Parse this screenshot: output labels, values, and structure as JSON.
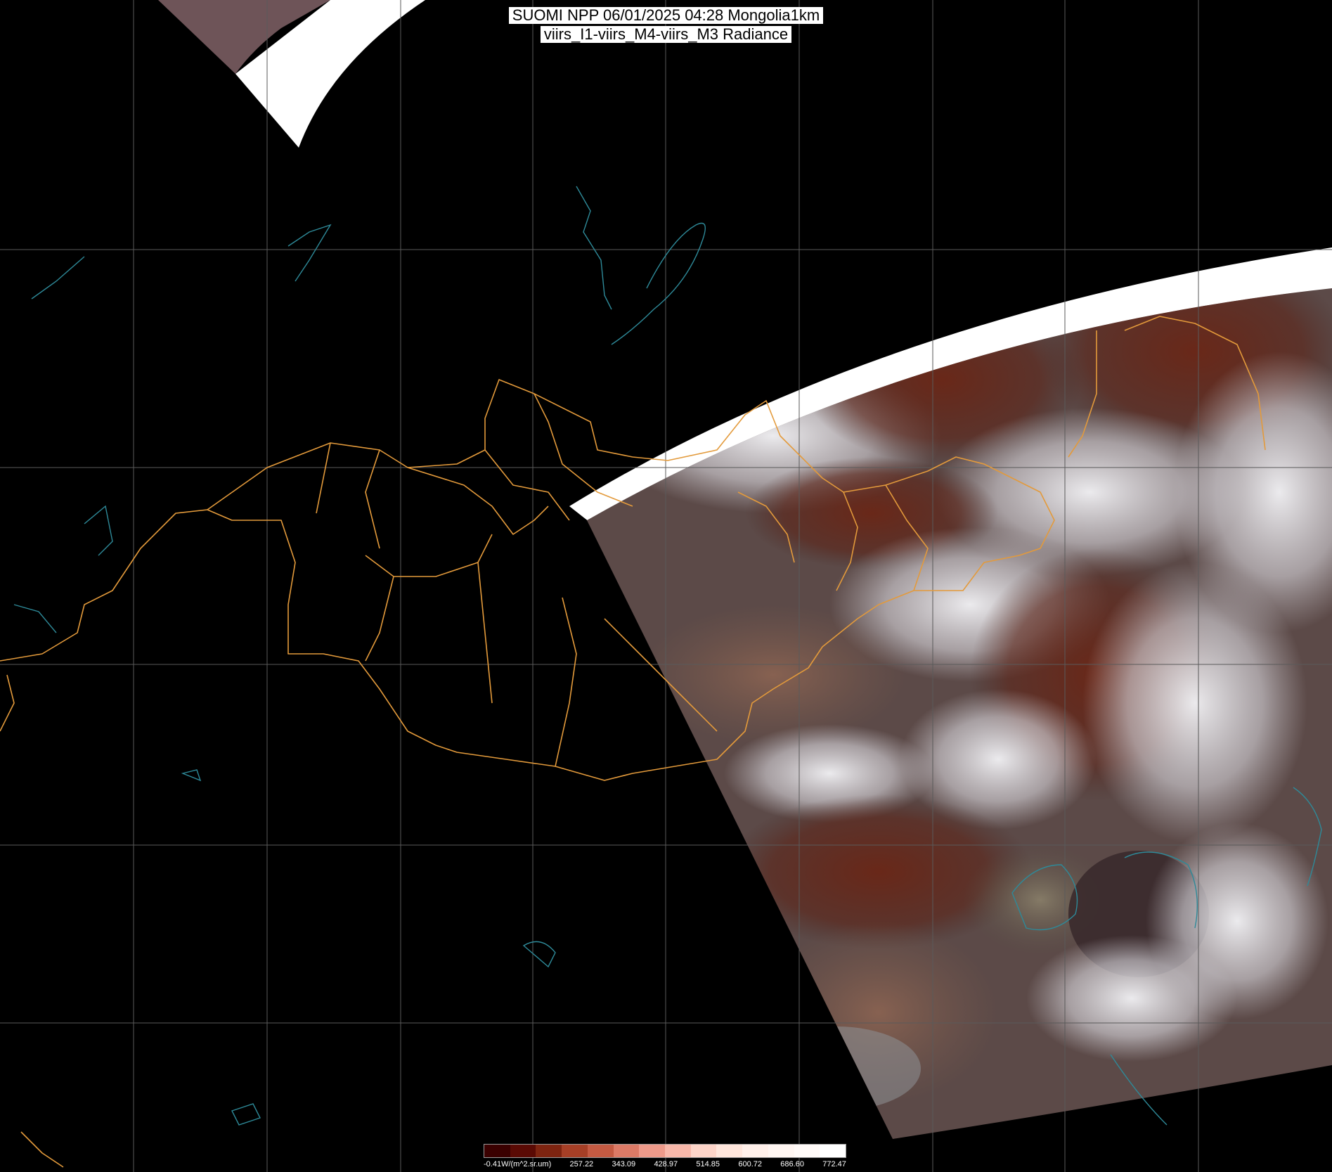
{
  "title": {
    "line1": "SUOMI NPP 06/01/2025 04:28 Mongolia1km",
    "line2": "viirs_I1-viirs_M4-viirs_M3 Radiance"
  },
  "legend": {
    "labels": [
      "-0.41W/(m^2.sr.um)",
      "257.22",
      "343.09",
      "428.97",
      "514.85",
      "600.72",
      "686.60",
      "772.47"
    ],
    "colors": [
      "#3a0000",
      "#5a0a04",
      "#7e2410",
      "#a63f26",
      "#c45a42",
      "#dc7a66",
      "#ee9a8a",
      "#f8b8aa",
      "#fdd4c8",
      "#ffe6dc",
      "#fff0ea",
      "#fff6f2",
      "#fffaf8",
      "#ffffff"
    ]
  },
  "colors": {
    "background": "#000000",
    "grid": "#5a5a5a",
    "borders": "#e39a3b",
    "coast": "#2e8a99",
    "swath_gap": "#ffffff"
  }
}
